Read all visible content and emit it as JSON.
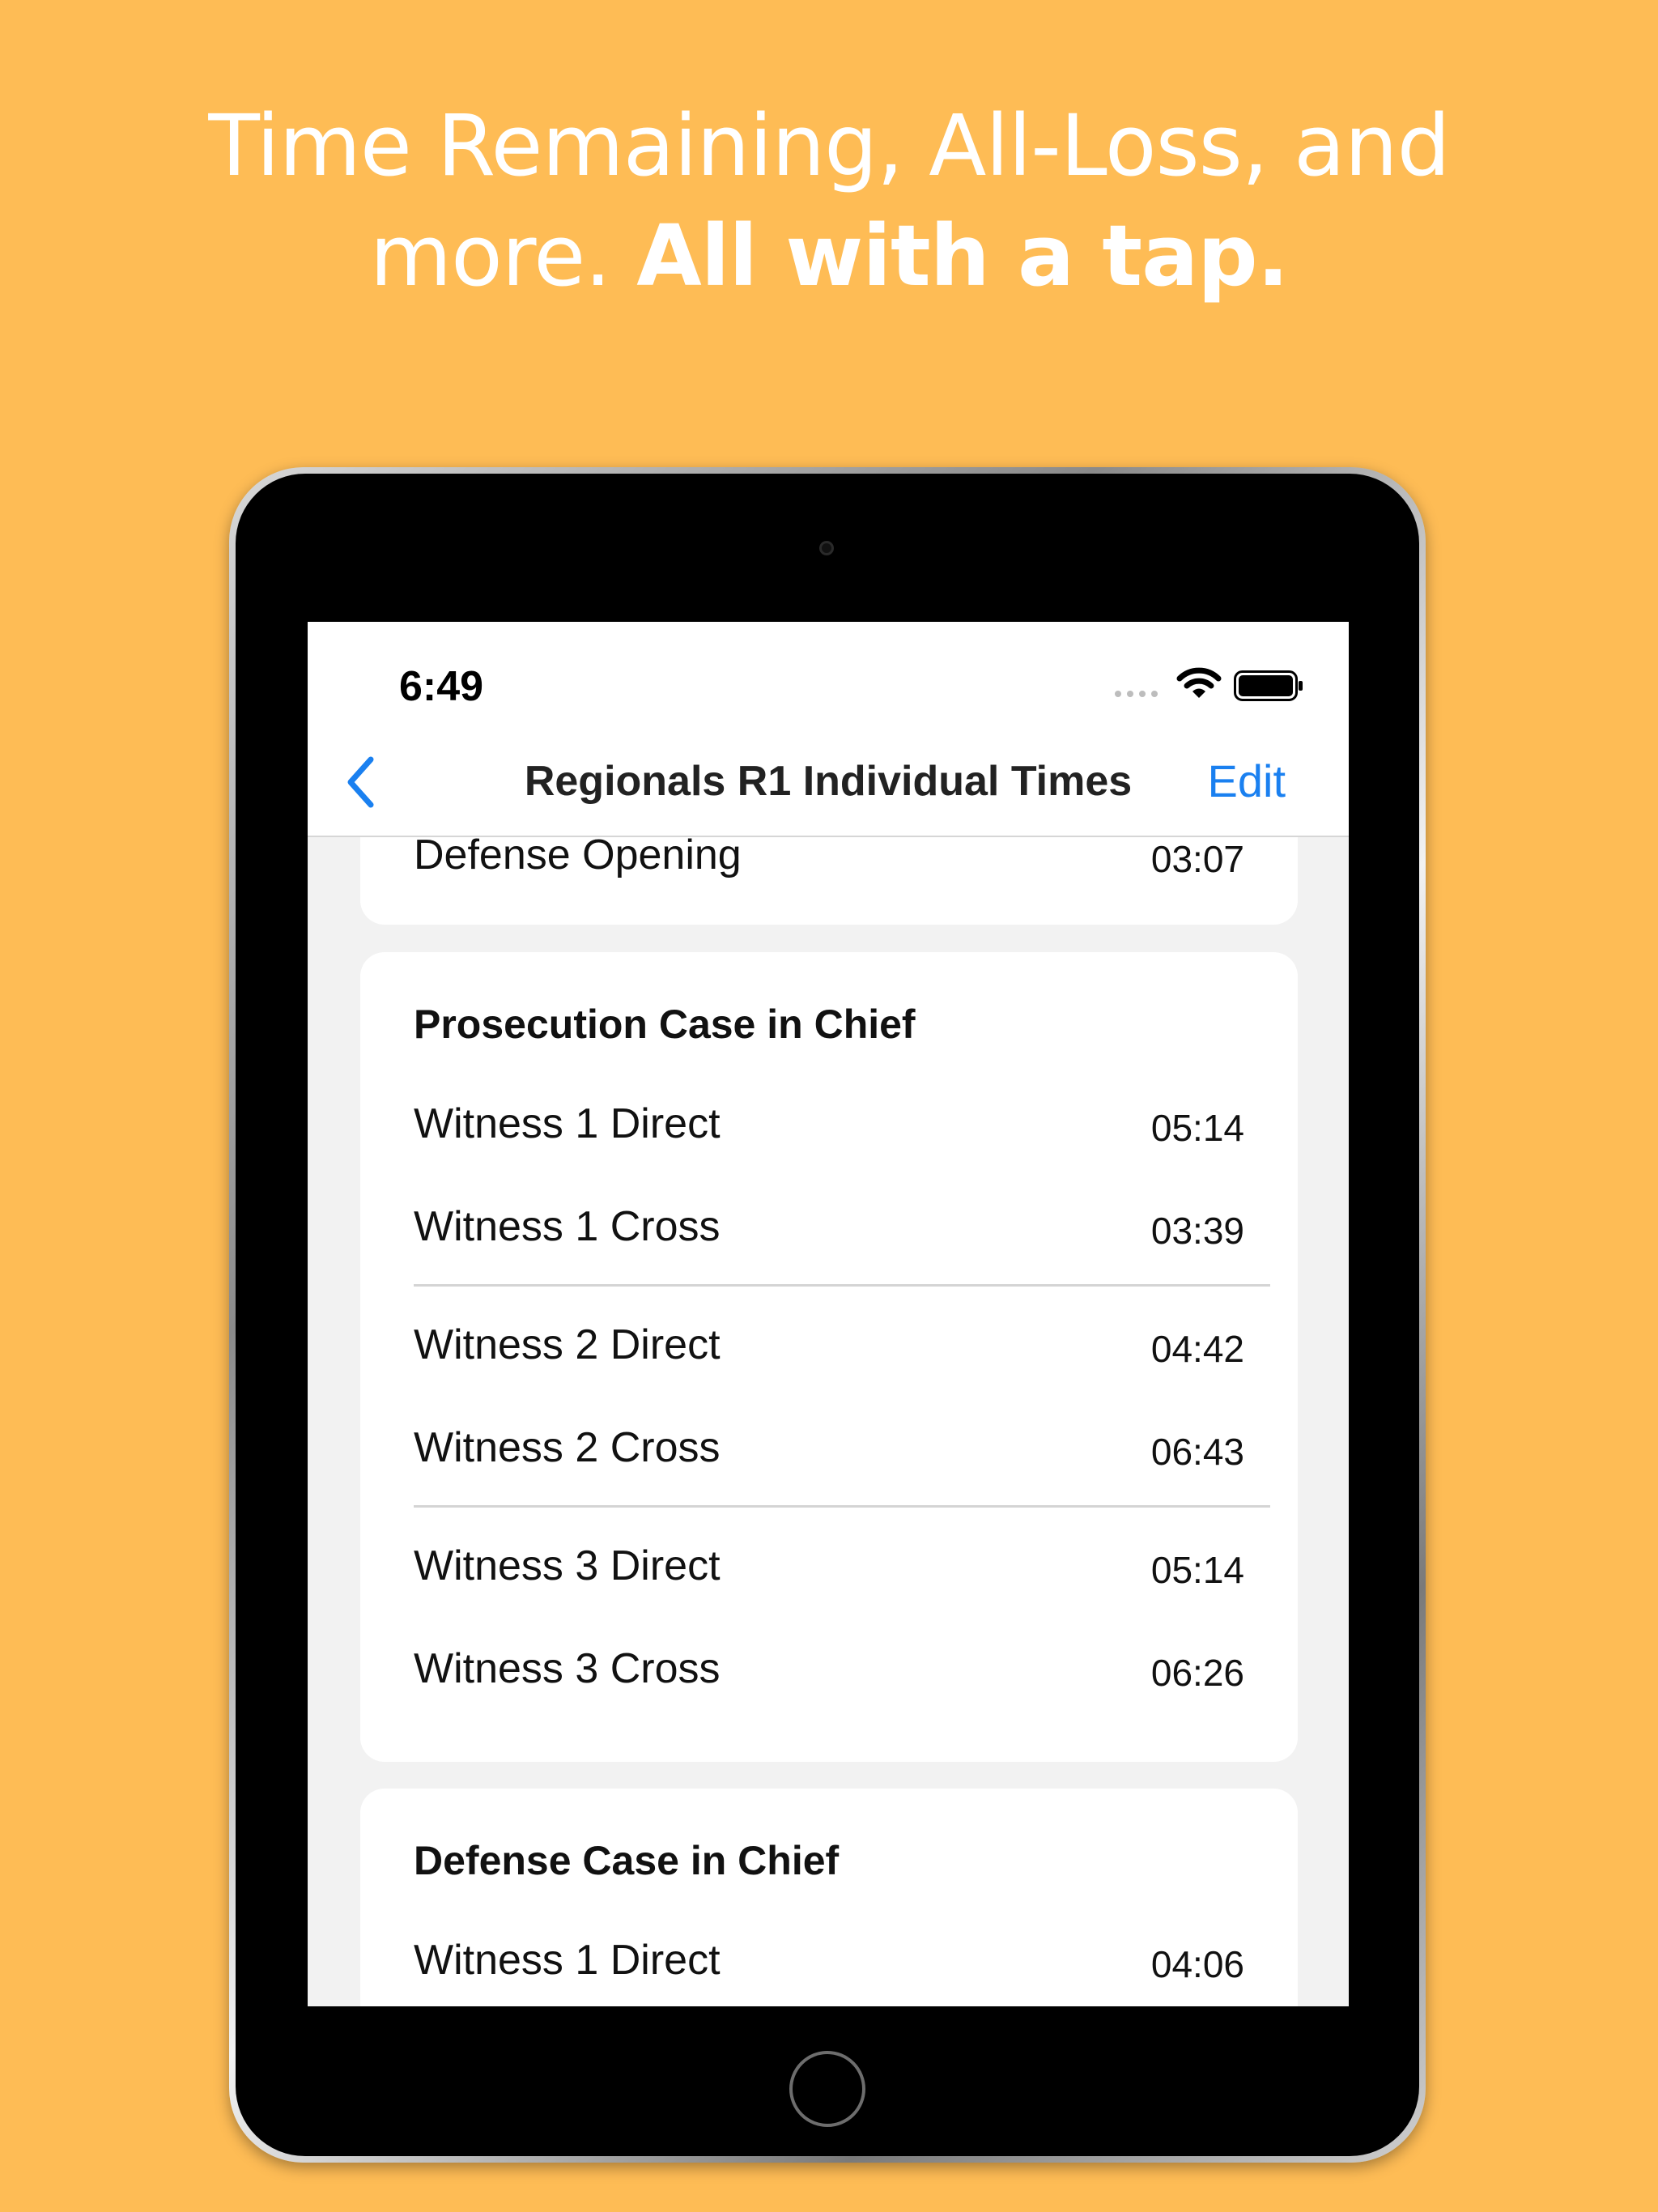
{
  "headline": {
    "line1": "Time Remaining, All-Loss, and",
    "line2_regular": "more. ",
    "line2_bold": "All with a tap."
  },
  "status_bar": {
    "time": "6:49"
  },
  "nav": {
    "title": "Regionals R1 Individual Times",
    "edit_label": "Edit"
  },
  "top_partial_row": {
    "label": "Defense Opening",
    "value": "03:07"
  },
  "prosecution": {
    "title": "Prosecution Case in Chief",
    "rows": [
      {
        "label": "Witness 1 Direct",
        "value": "05:14"
      },
      {
        "label": "Witness 1 Cross",
        "value": "03:39"
      },
      {
        "label": "Witness 2 Direct",
        "value": "04:42"
      },
      {
        "label": "Witness 2 Cross",
        "value": "06:43"
      },
      {
        "label": "Witness 3 Direct",
        "value": "05:14"
      },
      {
        "label": "Witness 3 Cross",
        "value": "06:26"
      }
    ]
  },
  "defense": {
    "title": "Defense Case in Chief",
    "rows": [
      {
        "label": "Witness 1 Direct",
        "value": "04:06"
      }
    ]
  },
  "colors": {
    "background": "#FEBC55",
    "accent": "#1A80F0"
  }
}
